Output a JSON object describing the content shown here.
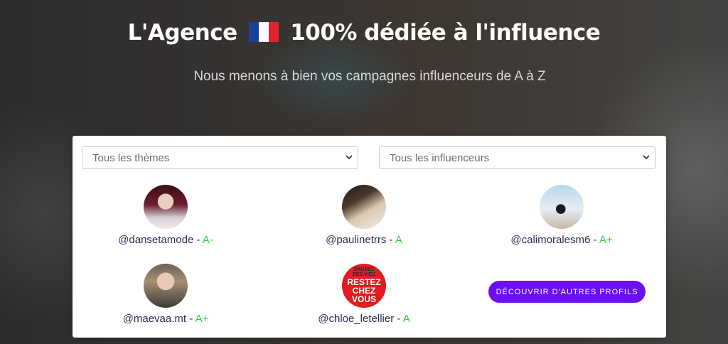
{
  "hero": {
    "title_before": "L'Agence",
    "title_after": "100% dédiée à l'influence",
    "flag_icon": "france-flag-icon",
    "subtitle": "Nous menons à bien vos campagnes influenceurs de A à Z"
  },
  "filters": {
    "themes_selected": "Tous les thèmes",
    "influencers_selected": "Tous les influenceurs"
  },
  "profiles": [
    {
      "handle": "@dansetamode",
      "sep": " - ",
      "grade": "A-"
    },
    {
      "handle": "@paulinetrrs",
      "sep": " - ",
      "grade": "A"
    },
    {
      "handle": "@calimoralesm6",
      "sep": " - ",
      "grade": "A+"
    },
    {
      "handle": "@maevaa.mt",
      "sep": " - ",
      "grade": "A+"
    },
    {
      "handle": "@chloe_letellier",
      "sep": " - ",
      "grade": "A"
    }
  ],
  "avatar5_text": [
    "SAUVEZ",
    "DES VIES",
    "RESTEZ",
    "CHEZ",
    "VOUS"
  ],
  "cta_label": "Découvrir d'autres profils",
  "colors": {
    "accent": "#6b0ff2",
    "grade": "#2ecc40",
    "handle": "#2b2f55"
  }
}
